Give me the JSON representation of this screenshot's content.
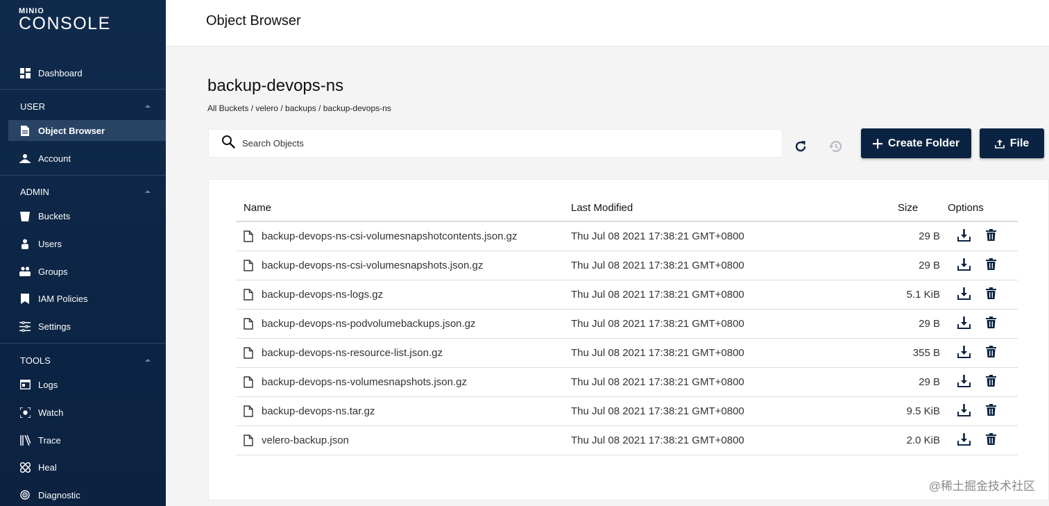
{
  "app": {
    "logo_top": "MINIO",
    "logo_main": "CONSOLE"
  },
  "sidebar": {
    "dashboard": "Dashboard",
    "sections": {
      "user": "USER",
      "admin": "ADMIN",
      "tools": "TOOLS"
    },
    "user_items": [
      "Object Browser",
      "Account"
    ],
    "admin_items": [
      "Buckets",
      "Users",
      "Groups",
      "IAM Policies",
      "Settings"
    ],
    "tools_items": [
      "Logs",
      "Watch",
      "Trace",
      "Heal",
      "Diagnostic"
    ]
  },
  "header": {
    "title": "Object Browser"
  },
  "bucket": {
    "title": "backup-devops-ns",
    "breadcrumb": "All Buckets / velero / backups / backup-devops-ns"
  },
  "toolbar": {
    "search_placeholder": "Search Objects",
    "create_folder": "Create Folder",
    "upload_file": "File"
  },
  "table": {
    "columns": {
      "name": "Name",
      "modified": "Last Modified",
      "size": "Size",
      "options": "Options"
    },
    "rows": [
      {
        "name": "backup-devops-ns-csi-volumesnapshotcontents.json.gz",
        "modified": "Thu Jul 08 2021 17:38:21 GMT+0800",
        "size": "29 B"
      },
      {
        "name": "backup-devops-ns-csi-volumesnapshots.json.gz",
        "modified": "Thu Jul 08 2021 17:38:21 GMT+0800",
        "size": "29 B"
      },
      {
        "name": "backup-devops-ns-logs.gz",
        "modified": "Thu Jul 08 2021 17:38:21 GMT+0800",
        "size": "5.1 KiB"
      },
      {
        "name": "backup-devops-ns-podvolumebackups.json.gz",
        "modified": "Thu Jul 08 2021 17:38:21 GMT+0800",
        "size": "29 B"
      },
      {
        "name": "backup-devops-ns-resource-list.json.gz",
        "modified": "Thu Jul 08 2021 17:38:21 GMT+0800",
        "size": "355 B"
      },
      {
        "name": "backup-devops-ns-volumesnapshots.json.gz",
        "modified": "Thu Jul 08 2021 17:38:21 GMT+0800",
        "size": "29 B"
      },
      {
        "name": "backup-devops-ns.tar.gz",
        "modified": "Thu Jul 08 2021 17:38:21 GMT+0800",
        "size": "9.5 KiB"
      },
      {
        "name": "velero-backup.json",
        "modified": "Thu Jul 08 2021 17:38:21 GMT+0800",
        "size": "2.0 KiB"
      }
    ]
  },
  "watermark": "@稀土掘金技术社区",
  "colors": {
    "sidebar": "#102a4c",
    "primary_button": "#0a2342",
    "active_item": "#2a4466"
  }
}
